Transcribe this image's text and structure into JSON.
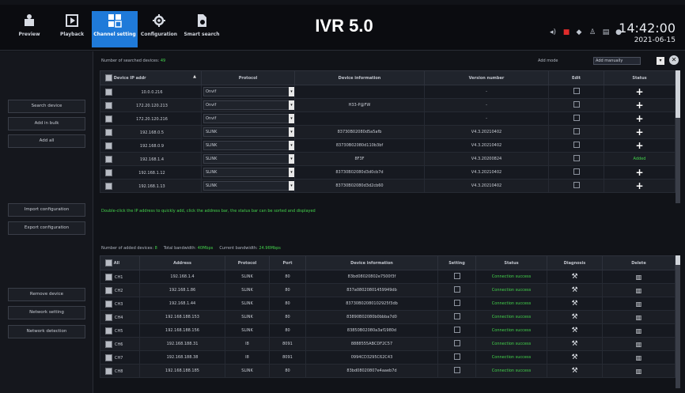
{
  "topbar": {
    "nav": [
      {
        "label": "Preview",
        "icon": "preview-icon"
      },
      {
        "label": "Playback",
        "icon": "playback-icon"
      },
      {
        "label": "Channel setting",
        "icon": "channel-setting-icon"
      },
      {
        "label": "Configuration",
        "icon": "configuration-icon"
      },
      {
        "label": "Smart search",
        "icon": "smart-search-icon"
      }
    ],
    "active_nav": "Channel setting",
    "title": "IVR 5.0",
    "time": "14:42:00",
    "date": "2021-06-15",
    "tray_icons": [
      "volume-icon",
      "record-icon",
      "network-icon",
      "users-icon",
      "storage-icon",
      "power-icon"
    ]
  },
  "sidebar": {
    "buttons": [
      "Search device",
      "Add in bulk",
      "Add all",
      "Import configuration",
      "Export configuration",
      "Remove device",
      "Network setting",
      "Network detection"
    ]
  },
  "search": {
    "count_label": "Number of searched devices:",
    "count": "49",
    "add_mode_label": "Add mode",
    "add_mode_value": "Add manually",
    "headers": [
      "Device IP addr",
      "Protocol",
      "Device information",
      "Version number",
      "Edit",
      "Status"
    ],
    "rows": [
      {
        "ip": "10.0.0.216",
        "protocol": "Onvif",
        "info": "",
        "version": "-",
        "status": "+"
      },
      {
        "ip": "172.20.120.213",
        "protocol": "Onvif",
        "info": "H33-P@FW",
        "version": "-",
        "status": "+"
      },
      {
        "ip": "172.20.120.216",
        "protocol": "Onvif",
        "info": "",
        "version": "-",
        "status": "+"
      },
      {
        "ip": "192.168.0.5",
        "protocol": "SLINK",
        "info": "83730B02080d5a5afb",
        "version": "V4.3.20210402",
        "status": "+"
      },
      {
        "ip": "192.168.0.9",
        "protocol": "SLINK",
        "info": "83730B02080d110b3bf",
        "version": "V4.3.20210402",
        "status": "+"
      },
      {
        "ip": "192.168.1.4",
        "protocol": "SLINK",
        "info": "8F3F",
        "version": "V4.3.20200824",
        "status": "Added"
      },
      {
        "ip": "192.168.1.12",
        "protocol": "SLINK",
        "info": "83730B02080d3d0cb7d",
        "version": "V4.3.20210402",
        "status": "+"
      },
      {
        "ip": "192.168.1.13",
        "protocol": "SLINK",
        "info": "83730B02080d3d2cb60",
        "version": "V4.3.20210402",
        "status": "+"
      }
    ],
    "hint": "Double-click the IP address to quickly add, click the address bar, the status bar can be sorted and displayed"
  },
  "added": {
    "count_label": "Number of added devices:",
    "count": "8",
    "total_bw_label": "Total bandwidth:",
    "total_bw": "40Mbps",
    "current_bw_label": "Current bandwidth:",
    "current_bw": "24.96Mbps",
    "headers": [
      "All",
      "Address",
      "Protocol",
      "Port",
      "Device information",
      "Setting",
      "Status",
      "Diagnosis",
      "Delete"
    ],
    "rows": [
      {
        "ch": "CH1",
        "address": "192.168.1.4",
        "protocol": "SLINK",
        "port": "80",
        "info": "83bd08020802e7500f3f",
        "status": "Connection success"
      },
      {
        "ch": "CH2",
        "address": "192.168.1.86",
        "protocol": "SLINK",
        "port": "80",
        "info": "837a08020801459949db",
        "status": "Connection success"
      },
      {
        "ch": "CH3",
        "address": "192.168.1.44",
        "protocol": "SLINK",
        "port": "80",
        "info": "83730B02080102925f3db",
        "status": "Connection success"
      },
      {
        "ch": "CH4",
        "address": "192.168.188.153",
        "protocol": "SLINK",
        "port": "80",
        "info": "83890B02080b0bbba7d0",
        "status": "Connection success"
      },
      {
        "ch": "CH5",
        "address": "192.168.188.156",
        "protocol": "SLINK",
        "port": "80",
        "info": "83850B02080a3af1980d",
        "status": "Connection success"
      },
      {
        "ch": "CH6",
        "address": "192.168.188.31",
        "protocol": "I8",
        "port": "8091",
        "info": "8888555ABCDF2C57",
        "status": "Connection success"
      },
      {
        "ch": "CH7",
        "address": "192.168.188.38",
        "protocol": "I8",
        "port": "8091",
        "info": "0994CD3295C62C43",
        "status": "Connection success"
      },
      {
        "ch": "CH8",
        "address": "192.168.188.185",
        "protocol": "SLINK",
        "port": "80",
        "info": "83bd08020807e4aaeb7d",
        "status": "Connection success"
      }
    ]
  }
}
